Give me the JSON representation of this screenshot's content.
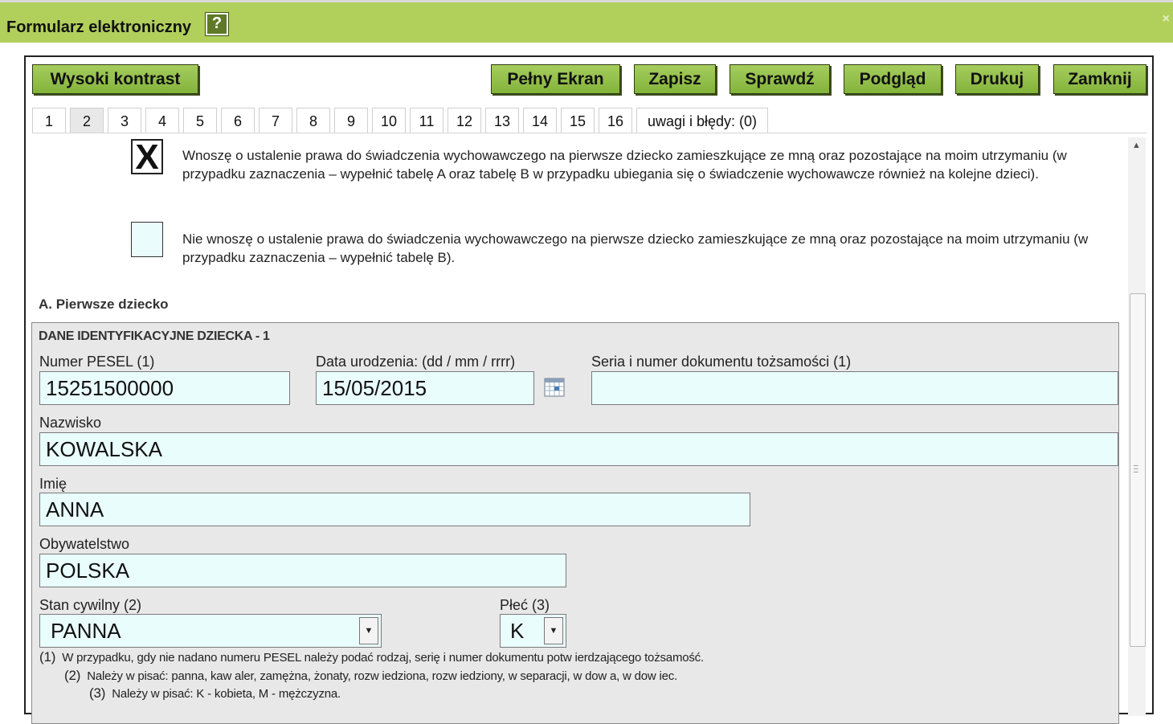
{
  "window": {
    "title": "Formularz elektroniczny",
    "help_label": "?",
    "close_label": "×"
  },
  "toolbar": {
    "high_contrast": "Wysoki kontrast",
    "full_screen": "Pełny Ekran",
    "save": "Zapisz",
    "check": "Sprawdź",
    "preview": "Podgląd",
    "print": "Drukuj",
    "close": "Zamknij"
  },
  "tabs": [
    "1",
    "2",
    "3",
    "4",
    "5",
    "6",
    "7",
    "8",
    "9",
    "10",
    "11",
    "12",
    "13",
    "14",
    "15",
    "16",
    "uwagi i błędy: (0)"
  ],
  "active_tab": "2",
  "options": {
    "option1": {
      "mark": "X",
      "text": "Wnoszę o ustalenie prawa do świadczenia wychowawczego na pierwsze dziecko zamieszkujące ze mną oraz pozostające na moim utrzymaniu (w przypadku zaznaczenia – wypełnić tabelę A oraz tabelę B w przypadku ubiegania się o świadczenie wychowawcze również na kolejne dzieci)."
    },
    "option2": {
      "mark": "",
      "text": "Nie wnoszę o ustalenie prawa do świadczenia wychowawczego na pierwsze dziecko zamieszkujące ze mną oraz pozostające na moim utrzymaniu (w przypadku zaznaczenia – wypełnić tabelę B)."
    }
  },
  "section": {
    "title": "A. Pierwsze dziecko",
    "panel_title": "DANE IDENTYFIKACYJNE DZIECKA - 1"
  },
  "fields": {
    "pesel": {
      "label": "Numer PESEL (1)",
      "value": "15251500000"
    },
    "birth_date": {
      "label": "Data urodzenia: (dd / mm / rrrr)",
      "value": "15/05/2015"
    },
    "id_document": {
      "label": "Seria i numer dokumentu tożsamości (1)",
      "value": ""
    },
    "surname": {
      "label": "Nazwisko",
      "value": "KOWALSKA"
    },
    "first_name": {
      "label": "Imię",
      "value": "ANNA"
    },
    "citizenship": {
      "label": "Obywatelstwo",
      "value": "POLSKA"
    },
    "marital_status": {
      "label": "Stan cywilny (2)",
      "value": "PANNA"
    },
    "sex": {
      "label": "Płeć (3)",
      "value": "K"
    }
  },
  "notes": [
    {
      "num": "(1)",
      "text": "W przypadku, gdy nie nadano numeru PESEL należy podać rodzaj, serię i numer dokumentu potw ierdzającego tożsamość."
    },
    {
      "num": "(2)",
      "text": "Należy w pisać: panna, kaw aler, zamężna, żonaty, rozw iedziona, rozw iedziony, w  separacji, w dow a, w dow iec."
    },
    {
      "num": "(3)",
      "text": "Należy w pisać: K - kobieta, M - mężczyzna."
    }
  ],
  "icons": {
    "help": "help-icon",
    "close": "close-icon",
    "calendar": "calendar-icon",
    "dropdown": "chevron-down-icon",
    "scroll_up": "arrow-up-icon"
  },
  "colors": {
    "title_bar": "#b1cf5b",
    "button": "#8fbe46",
    "input_bg": "#eafdfd",
    "panel_bg": "#e9e8e8"
  }
}
